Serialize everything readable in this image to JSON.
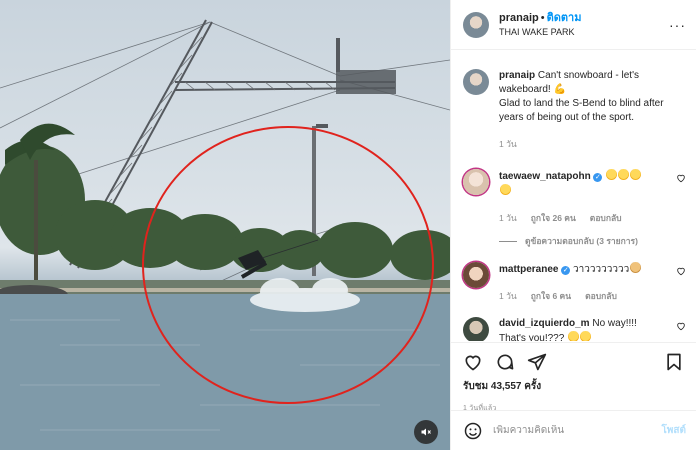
{
  "post": {
    "username": "pranaip",
    "follow_label": "ติดตาม",
    "location": "THAI WAKE PARK"
  },
  "caption": {
    "username": "pranaip",
    "line1": "Can't snowboard - let's wakeboard!",
    "line2": "Glad to land the S-Bend to blind after years of being out of the sport.",
    "time": "1 วัน"
  },
  "comments": [
    {
      "username": "taewaew_natapohn",
      "text": "",
      "time": "1 วัน",
      "likes": "ถูกใจ 26 คน",
      "reply_label": "ตอบกลับ",
      "view_replies": "ดูข้อความตอบกลับ (3 รายการ)"
    },
    {
      "username": "mattperanee",
      "text": "วาวววววววว",
      "time": "1 วัน",
      "likes": "ถูกใจ 6 คน",
      "reply_label": "ตอบกลับ"
    },
    {
      "username": "david_izquierdo_m",
      "text_line1": "No way!!!!",
      "text_line2": "That's you!???"
    }
  ],
  "stats": {
    "views": "รับชม 43,557 ครั้ง",
    "posted": "1 วันที่แล้ว"
  },
  "composer": {
    "placeholder": "เพิ่มความคิดเห็น",
    "post_label": "โพสต์"
  },
  "icons": {
    "like": "heart-icon",
    "comment": "comment-icon",
    "share": "paper-plane-icon",
    "save": "bookmark-icon",
    "sound": "speaker-muted-icon",
    "emoji": "smiley-icon",
    "more": "more-dots-icon"
  },
  "colors": {
    "link_blue": "#0095f6",
    "circle_red": "#e0231d",
    "muted": "#8e8e8e"
  }
}
